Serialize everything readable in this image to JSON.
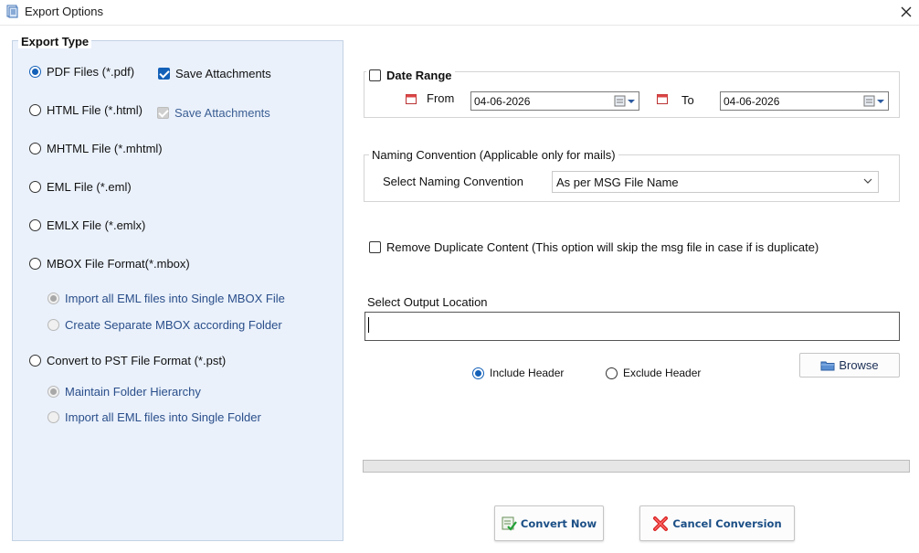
{
  "window": {
    "title": "Export Options",
    "close_icon": "close-icon",
    "app_icon": "app-icon"
  },
  "export_type": {
    "legend": "Export Type",
    "pdf": {
      "label": "PDF Files (*.pdf)",
      "selected": true
    },
    "pdf_save_attachments": {
      "label": "Save Attachments",
      "checked": true
    },
    "html": {
      "label": "HTML File  (*.html)",
      "selected": false
    },
    "html_save_attachments": {
      "label": "Save Attachments",
      "checked": true,
      "disabled": true
    },
    "mhtml": {
      "label": "MHTML File  (*.mhtml)",
      "selected": false
    },
    "eml": {
      "label": "EML File (*.eml)",
      "selected": false
    },
    "emlx": {
      "label": "EMLX File (*.emlx)",
      "selected": false
    },
    "mbox": {
      "label": "MBOX File Format(*.mbox)",
      "selected": false
    },
    "mbox_single": {
      "label": "Import all EML files into Single MBOX File",
      "selected": true,
      "disabled": true
    },
    "mbox_separate": {
      "label": "Create Separate MBOX according Folder",
      "selected": false,
      "disabled": true
    },
    "pst": {
      "label": "Convert to PST File Format (*.pst)",
      "selected": false
    },
    "pst_hierarchy": {
      "label": "Maintain Folder Hierarchy",
      "selected": true,
      "disabled": true
    },
    "pst_single": {
      "label": "Import all EML files into Single Folder",
      "selected": false,
      "disabled": true
    }
  },
  "date_range": {
    "label": "Date Range",
    "checked": false,
    "from_label": "From",
    "from_value": "04-06-2026",
    "to_label": "To",
    "to_value": "04-06-2026"
  },
  "naming": {
    "legend": "Naming Convention (Applicable only for mails)",
    "select_label": "Select Naming Convention",
    "selected_value": "As per MSG File Name"
  },
  "remove_duplicate": {
    "label": "Remove Duplicate Content (This option will skip the msg file in case if is duplicate)",
    "checked": false
  },
  "output": {
    "label": "Select Output Location",
    "value": "",
    "browse_label": "Browse"
  },
  "header_options": {
    "include_label": "Include Header",
    "include_selected": true,
    "exclude_label": "Exclude Header",
    "exclude_selected": false
  },
  "progress": {
    "fraction": 0
  },
  "actions": {
    "convert_label": "Convert Now",
    "cancel_label": "Cancel Conversion"
  },
  "colors": {
    "accent": "#1360b8",
    "panel_bg": "#eaf1fb",
    "button_text": "#1b4f86"
  }
}
